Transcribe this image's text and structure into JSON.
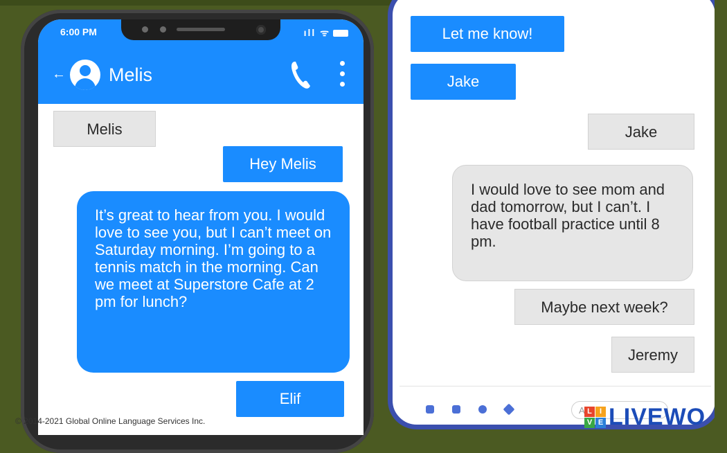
{
  "left_phone": {
    "status": {
      "time": "6:00 PM",
      "signal": "ıll ᯤ"
    },
    "header": {
      "back": "←",
      "contact_name": "Melis"
    },
    "messages": [
      {
        "from": "them",
        "text": "Melis"
      },
      {
        "from": "me",
        "text": "Hey Melis"
      },
      {
        "from": "me",
        "text": "It’s great to hear from you. I would love to see you, but I can’t meet on Saturday morning. I’m going to a tennis match in the morning. Can we meet at Superstore Cafe at 2 pm for lunch?"
      },
      {
        "from": "me",
        "text": "Elif"
      }
    ]
  },
  "right_phone": {
    "messages": [
      {
        "from": "me",
        "text": "Let me know!"
      },
      {
        "from": "me",
        "text": "Jake"
      },
      {
        "from": "them",
        "text": "Jake"
      },
      {
        "from": "them",
        "text": "I would love to see mom and dad tomorrow, but I can’t. I have football practice until 8 pm."
      },
      {
        "from": "them",
        "text": "Maybe next week?"
      },
      {
        "from": "them",
        "text": "Jeremy"
      }
    ],
    "composer": {
      "placeholder": "Aa"
    }
  },
  "footer": {
    "copyright": "© 2014-2021 Global Online Language Services Inc.",
    "logo_tiles": [
      "L",
      "I",
      "V",
      "E"
    ],
    "logo_word": "LIVEWO"
  },
  "colors": {
    "background": "#4b5a22",
    "blue_bubble": "#1a8cff",
    "gray_bubble": "#e6e6e6",
    "right_frame": "#3b4fae"
  }
}
